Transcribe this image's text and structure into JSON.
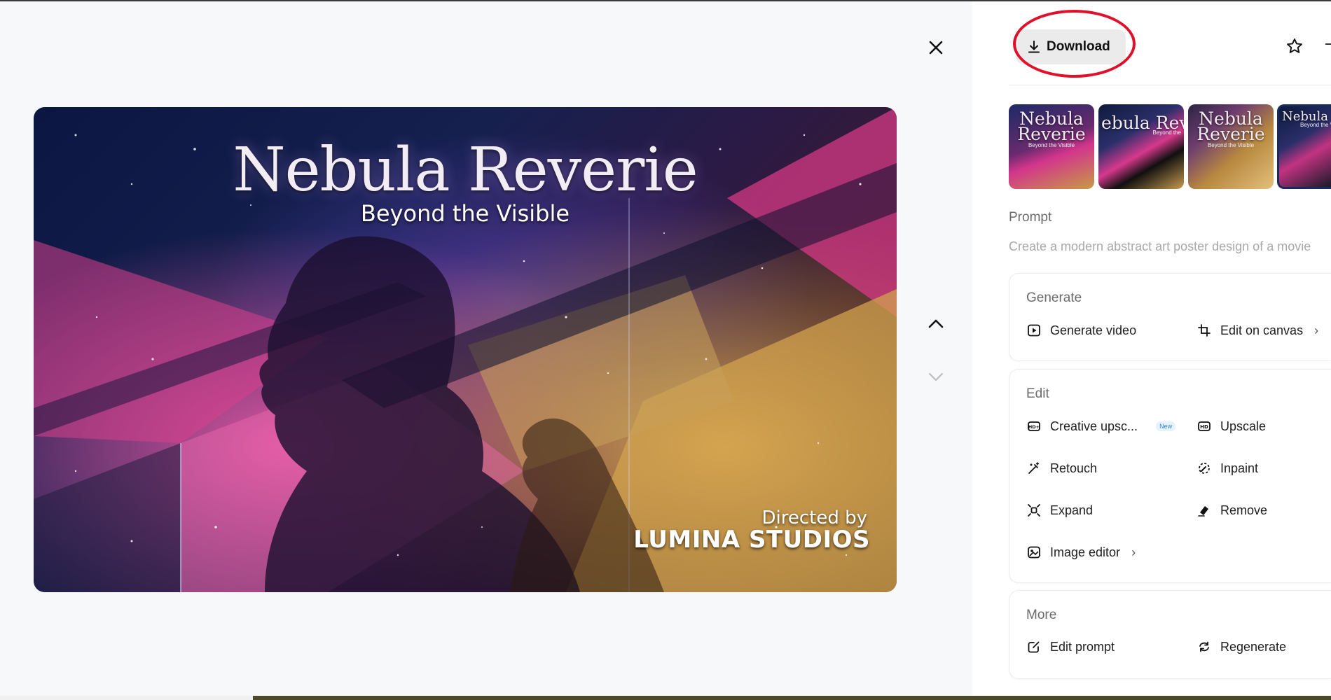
{
  "viewer": {
    "close_icon": "close-icon",
    "nav_up_icon": "chevron-up-icon",
    "nav_down_icon": "chevron-down-icon",
    "poster": {
      "title": "Nebula Reverie",
      "subtitle": "Beyond the Visible",
      "credit_line1": "Directed by",
      "credit_line2": "LUMINA STUDIOS"
    }
  },
  "panel": {
    "download_label": "Download",
    "download_icon": "download-icon",
    "star_icon": "star-icon",
    "thumbnails": [
      {
        "title": "Nebula Reverie",
        "subtitle": "Beyond the Visible"
      },
      {
        "title": "ebula Rever",
        "subtitle": "Beyond the"
      },
      {
        "title": "Nebula Reverie",
        "subtitle": "Beyond the Visible"
      },
      {
        "title": "Nebula Re",
        "subtitle": "Beyond the Vis"
      }
    ],
    "prompt_label": "Prompt",
    "prompt_text": "Create a modern abstract art poster design of a movie",
    "generate": {
      "title": "Generate",
      "items": [
        {
          "label": "Generate video",
          "icon": "play-box-icon"
        },
        {
          "label": "Edit on canvas",
          "icon": "crop-icon"
        }
      ]
    },
    "edit": {
      "title": "Edit",
      "items": [
        {
          "label": "Creative upsc...",
          "icon": "hd-plus-icon",
          "badge": "New"
        },
        {
          "label": "Upscale",
          "icon": "hd-icon"
        },
        {
          "label": "Retouch",
          "icon": "magic-wand-icon"
        },
        {
          "label": "Inpaint",
          "icon": "inpaint-icon"
        },
        {
          "label": "Expand",
          "icon": "expand-icon"
        },
        {
          "label": "Remove",
          "icon": "eraser-icon"
        },
        {
          "label": "Image editor",
          "icon": "image-editor-icon"
        }
      ]
    },
    "more": {
      "title": "More",
      "items": [
        {
          "label": "Edit prompt",
          "icon": "edit-prompt-icon"
        },
        {
          "label": "Regenerate",
          "icon": "regenerate-icon"
        }
      ]
    }
  },
  "colors": {
    "viewer_bg": "#f7f8fa",
    "annotation_ring": "#e0102a",
    "download_bg": "#ebebec",
    "badge_text": "#2a88e0"
  }
}
